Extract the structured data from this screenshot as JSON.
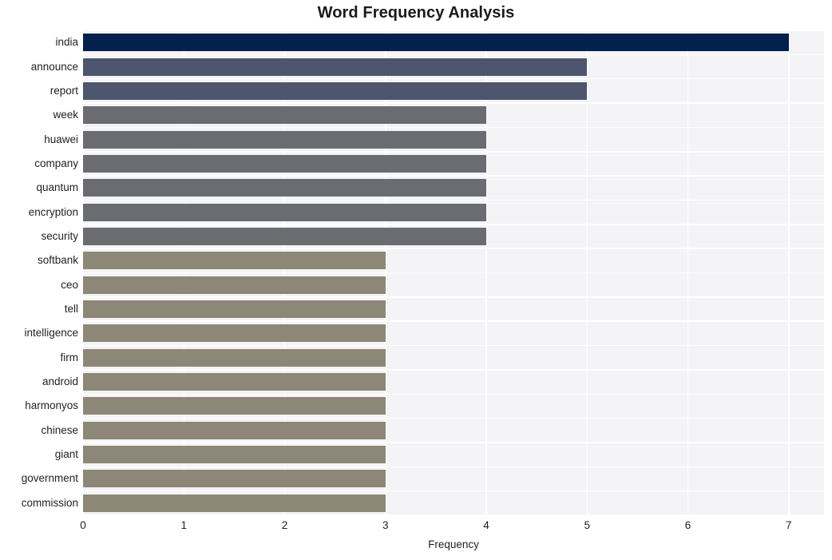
{
  "chart_data": {
    "type": "bar",
    "orientation": "horizontal",
    "title": "Word Frequency Analysis",
    "xlabel": "Frequency",
    "ylabel": "",
    "xlim": [
      0,
      7.35
    ],
    "ylim": [
      0,
      20
    ],
    "grid": true,
    "legend": false,
    "xticks": [
      "0",
      "1",
      "2",
      "3",
      "4",
      "5",
      "6",
      "7"
    ],
    "xtick_values": [
      0,
      1,
      2,
      3,
      4,
      5,
      6,
      7
    ],
    "categories": [
      "india",
      "announce",
      "report",
      "week",
      "huawei",
      "company",
      "quantum",
      "encryption",
      "security",
      "softbank",
      "ceo",
      "tell",
      "intelligence",
      "firm",
      "android",
      "harmonyos",
      "chinese",
      "giant",
      "government",
      "commission"
    ],
    "values": [
      7,
      5,
      5,
      4,
      4,
      4,
      4,
      4,
      4,
      3,
      3,
      3,
      3,
      3,
      3,
      3,
      3,
      3,
      3,
      3
    ],
    "bar_colors": [
      "#04204d",
      "#4d556f",
      "#4d556f",
      "#6a6c72",
      "#6a6c72",
      "#6a6c72",
      "#6a6c72",
      "#6a6c72",
      "#6a6c72",
      "#8d8777",
      "#8d8777",
      "#8d8777",
      "#8d8777",
      "#8d8777",
      "#8d8777",
      "#8d8777",
      "#8d8777",
      "#8d8777",
      "#8d8777",
      "#8d8777"
    ]
  },
  "style": {
    "plot_background": "#f4f4f6",
    "grid_color": "#ffffff",
    "figure_background": "#ffffff",
    "text_color": "#222222",
    "title_color": "#1a1a1a"
  }
}
